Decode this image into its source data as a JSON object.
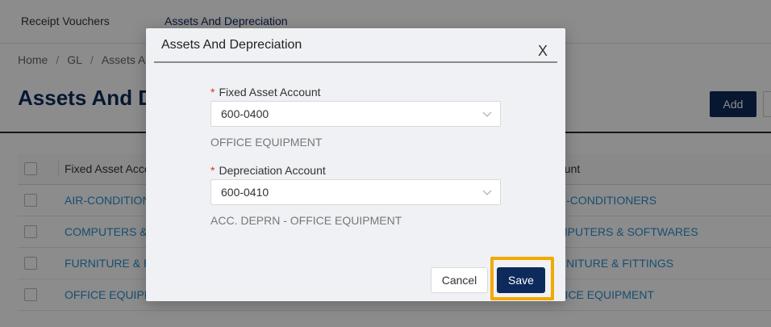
{
  "topnav": {
    "tabs": [
      {
        "label": "Receipt Vouchers"
      },
      {
        "label": "Assets And Depreciation"
      }
    ]
  },
  "breadcrumb": {
    "items": [
      "Home",
      "GL",
      "Assets A"
    ],
    "separator": "/"
  },
  "page": {
    "title": "Assets And De",
    "add_label": "Add"
  },
  "table": {
    "headers": [
      "Fixed Asset Acco",
      "ount"
    ],
    "rows": [
      {
        "col1": "AIR-CONDITION",
        "col2": "R-CONDITIONERS"
      },
      {
        "col1": "COMPUTERS & S",
        "col2": "MPUTERS & SOFTWARES"
      },
      {
        "col1": "FURNITURE & FI",
        "col2": "RNITURE & FITTINGS"
      },
      {
        "col1": "OFFICE EQUIPM",
        "col2": "FICE EQUIPMENT"
      }
    ]
  },
  "modal": {
    "title": "Assets And Depreciation",
    "close_icon": "close-icon",
    "fixed_asset": {
      "label": "Fixed Asset Account",
      "required_mark": "*",
      "value": "600-0400",
      "description": "OFFICE EQUIPMENT"
    },
    "depreciation": {
      "label": "Depreciation Account",
      "required_mark": "*",
      "value": "600-0410",
      "description": "ACC. DEPRN - OFFICE EQUIPMENT"
    },
    "cancel_label": "Cancel",
    "save_label": "Save",
    "close_glyph": "X"
  },
  "colors": {
    "primary": "#0d2a5c",
    "link": "#2a8fd0",
    "highlight": "#f2a900",
    "required": "#e0301e"
  }
}
